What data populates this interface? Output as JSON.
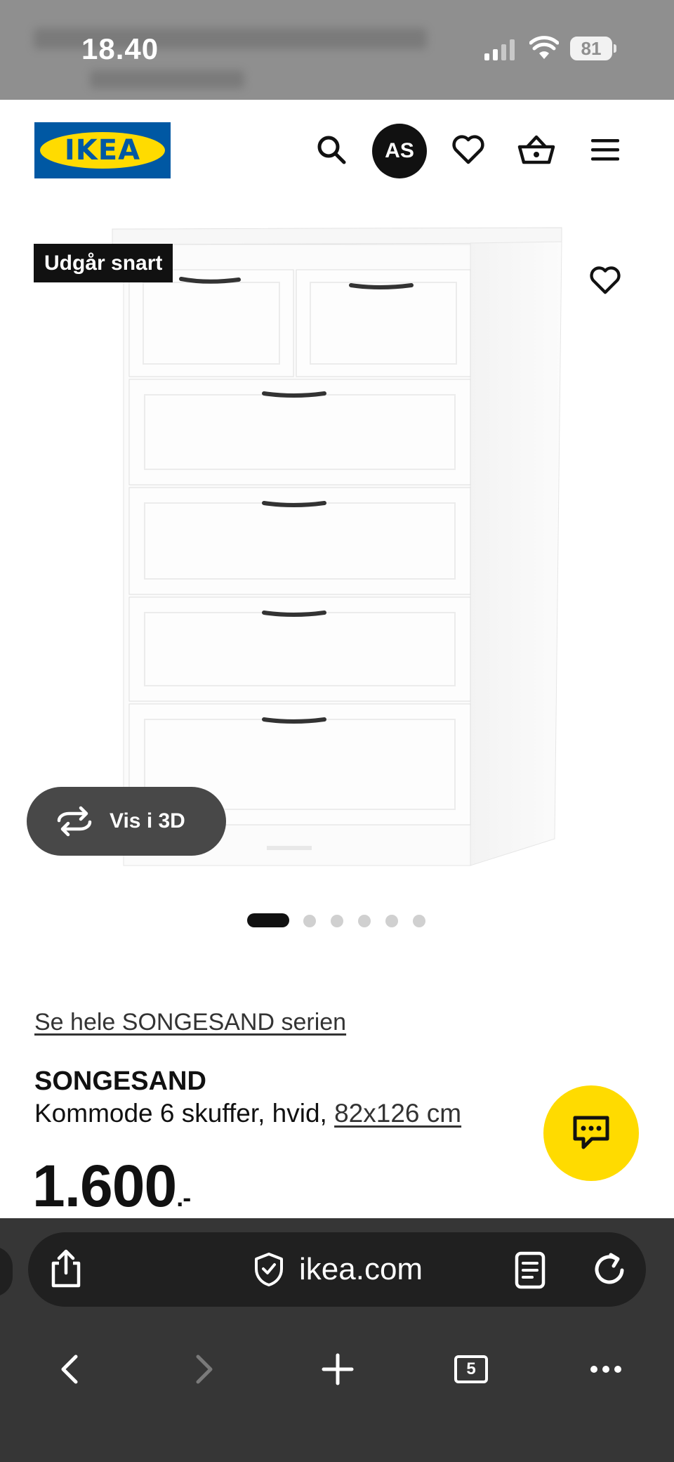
{
  "status_bar": {
    "time": "18.40",
    "battery": "81",
    "signal_icon": "cellular-signal-icon",
    "wifi_icon": "wifi-icon"
  },
  "header": {
    "logo_text": "IKEA",
    "avatar_initials": "AS",
    "icons": [
      "search-icon",
      "favorites-heart-icon",
      "shopping-basket-icon",
      "menu-hamburger-icon"
    ]
  },
  "gallery": {
    "badge": "Udgår snart",
    "view_3d_label": "Vis i 3D",
    "image_count": 6,
    "active_image": 1
  },
  "product": {
    "series_link": "Se hele SONGESAND serien",
    "name": "SONGESAND",
    "description": "Kommode 6 skuffer, hvid, ",
    "dimensions": "82x126 cm",
    "price": "1.600",
    "price_suffix": ".-"
  },
  "browser": {
    "url": "ikea.com",
    "tab_count": "5"
  },
  "colors": {
    "ikea_blue": "#0058a3",
    "ikea_yellow": "#ffdb00",
    "badge_bg": "#111111",
    "toolbar_bg": "#363636"
  }
}
